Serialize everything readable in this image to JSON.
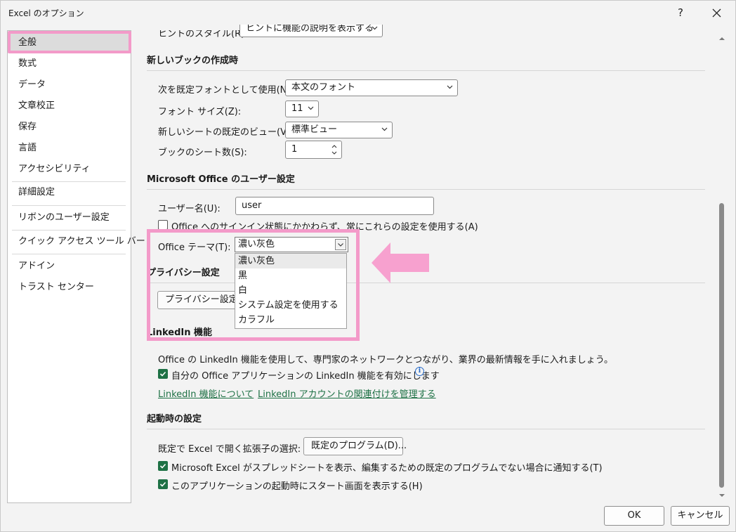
{
  "window": {
    "title": "Excel のオプション",
    "help_label": "?"
  },
  "sidebar": {
    "items": [
      {
        "label": "全般"
      },
      {
        "label": "数式"
      },
      {
        "label": "データ"
      },
      {
        "label": "文章校正"
      },
      {
        "label": "保存"
      },
      {
        "label": "言語"
      },
      {
        "label": "アクセシビリティ"
      },
      {
        "label": "詳細設定"
      },
      {
        "label": "リボンのユーザー設定"
      },
      {
        "label": "クイック アクセス ツール バー"
      },
      {
        "label": "アドイン"
      },
      {
        "label": "トラスト センター"
      }
    ]
  },
  "top_partial": {
    "label": "ヒントのスタイル(R):",
    "value": "ヒントに機能の説明を表示する"
  },
  "new_workbook": {
    "title": "新しいブックの作成時",
    "font_label": "次を既定フォントとして使用(N):",
    "font_value": "本文のフォント",
    "size_label": "フォント サイズ(Z):",
    "size_value": "11",
    "view_label": "新しいシートの既定のビュー(V):",
    "view_value": "標準ビュー",
    "sheets_label": "ブックのシート数(S):",
    "sheets_value": "1"
  },
  "user_settings": {
    "title": "Microsoft Office のユーザー設定",
    "username_label": "ユーザー名(U):",
    "username_value": "user",
    "always_use_label": "Office へのサインイン状態にかかわらず、常にこれらの設定を使用する(A)",
    "theme_label": "Office テーマ(T):",
    "theme_value": "濃い灰色",
    "theme_options": [
      "濃い灰色",
      "黒",
      "白",
      "システム設定を使用する",
      "カラフル"
    ]
  },
  "privacy": {
    "title": "プライバシー設定",
    "button_label": "プライバシー設定..."
  },
  "linkedin": {
    "title": "LinkedIn 機能",
    "description": "Office の LinkedIn 機能を使用して、専門家のネットワークとつながり、業界の最新情報を手に入れましょう。",
    "enable_label": "自分の Office アプリケーションの LinkedIn 機能を有効にします",
    "link_about": "LinkedIn 機能について",
    "link_manage": "LinkedIn アカウントの関連付けを管理する",
    "enable_checked": true
  },
  "startup": {
    "title": "起動時の設定",
    "ext_label": "既定で Excel で開く拡張子の選択:",
    "default_programs_label": "既定のプログラム(D)...",
    "notify_label": "Microsoft Excel がスプレッドシートを表示、編集するための既定のプログラムでない場合に通知する(T)",
    "start_screen_label": "このアプリケーションの起動時にスタート画面を表示する(H)",
    "notify_checked": true,
    "start_screen_checked": true
  },
  "footer": {
    "ok_label": "OK",
    "cancel_label": "キャンセル"
  },
  "colors": {
    "accent_green": "#1e7145",
    "highlight_pink": "#f39ac9"
  }
}
